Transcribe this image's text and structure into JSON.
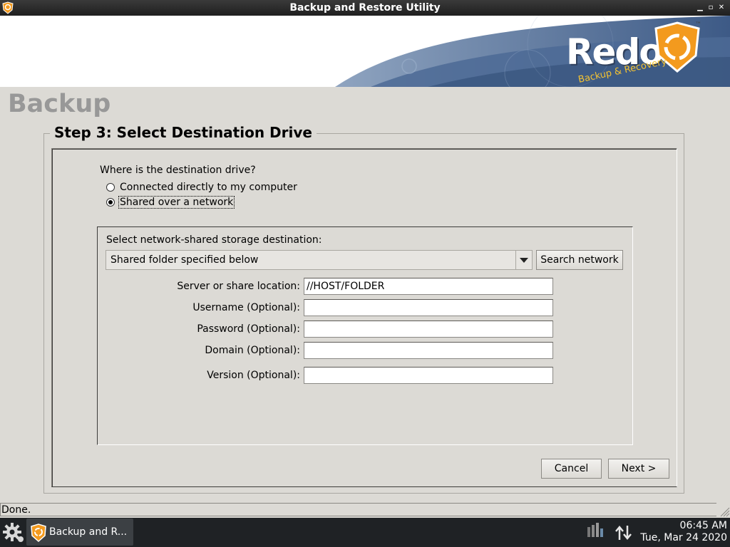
{
  "window": {
    "title": "Backup and Restore Utility"
  },
  "banner": {
    "brand": "Redo",
    "tagline": "Backup & Recovery",
    "trademark": "™"
  },
  "page": {
    "title": "Backup",
    "step_title": "Step 3: Select Destination Drive"
  },
  "destination": {
    "question": "Where is the destination drive?",
    "options": [
      {
        "label": "Connected directly to my computer",
        "selected": false
      },
      {
        "label": "Shared over a network",
        "selected": true
      }
    ]
  },
  "network": {
    "prompt": "Select network-shared storage destination:",
    "combo_value": "Shared folder specified below",
    "search_button": "Search network",
    "fields": [
      {
        "label": "Server or share location:",
        "value": "//HOST/FOLDER"
      },
      {
        "label": "Username (Optional):",
        "value": ""
      },
      {
        "label": "Password (Optional):",
        "value": ""
      },
      {
        "label": "Domain (Optional):",
        "value": ""
      },
      {
        "label": "Version (Optional):",
        "value": ""
      }
    ]
  },
  "buttons": {
    "cancel": "Cancel",
    "next": "Next >"
  },
  "status": {
    "text": "Done."
  },
  "taskbar": {
    "task_label": "Backup and R...",
    "time": "06:45 AM",
    "date": "Tue, Mar 24 2020"
  },
  "colors": {
    "accent_orange": "#f39a1e",
    "banner_blue": "#4c6a95",
    "taskbar_bg": "#1f2225"
  }
}
